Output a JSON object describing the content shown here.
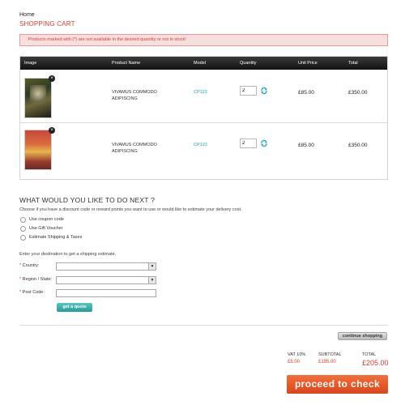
{
  "breadcrumb": "Home",
  "page_title": "SHOPPING CART",
  "warning": "Products marked with (*) are not available in the desired quantity or not in stock!",
  "table": {
    "headers": {
      "image": "Image",
      "product_name": "Product Name",
      "model": "Model",
      "quantity": "Quantity",
      "unit_price": "Unit Price",
      "total": "Total"
    },
    "rows": [
      {
        "name": "VIVAMUS COMMODO ADIPISCING",
        "model": "CP123",
        "quantity": "2",
        "unit_price": "£85.00",
        "total": "£350.00",
        "remove_icon": "×"
      },
      {
        "name": "VIVAMUS COMMODO ADIPISCING",
        "model": "CP123",
        "quantity": "2",
        "unit_price": "£85.00",
        "total": "£350.00",
        "remove_icon": "×"
      }
    ]
  },
  "next_steps": {
    "title": "WHAT WOULD YOU LIKE TO DO NEXT ?",
    "description": "Choose if you have a discount code or reward points you want to use or would like to estimate your delivery cost.",
    "options": [
      "Use coupon code",
      "Use Gift Voucher",
      "Estimate Shipping & Taxes"
    ]
  },
  "shipping": {
    "description": "Enter your destination to get a shipping estimate.",
    "required_mark": "*",
    "country_label": "Country:",
    "region_label": "Region / State:",
    "postcode_label": "Post Code:",
    "quote_button": "get a quote"
  },
  "continue_button": "continue shopping",
  "summary": {
    "vat_label": "VAT 10%",
    "vat_value": "£5.00",
    "subtotal_label": "SUBTOTAL",
    "subtotal_value": "£195.00",
    "total_label": "TOTAL",
    "total_value": "£205.00"
  },
  "proceed_button": "proceed to check",
  "colors": {
    "accent": "#e23c2a",
    "model_link": "#1fa6b5",
    "proceed": "#e8551f",
    "quote": "#3bb3ae"
  }
}
